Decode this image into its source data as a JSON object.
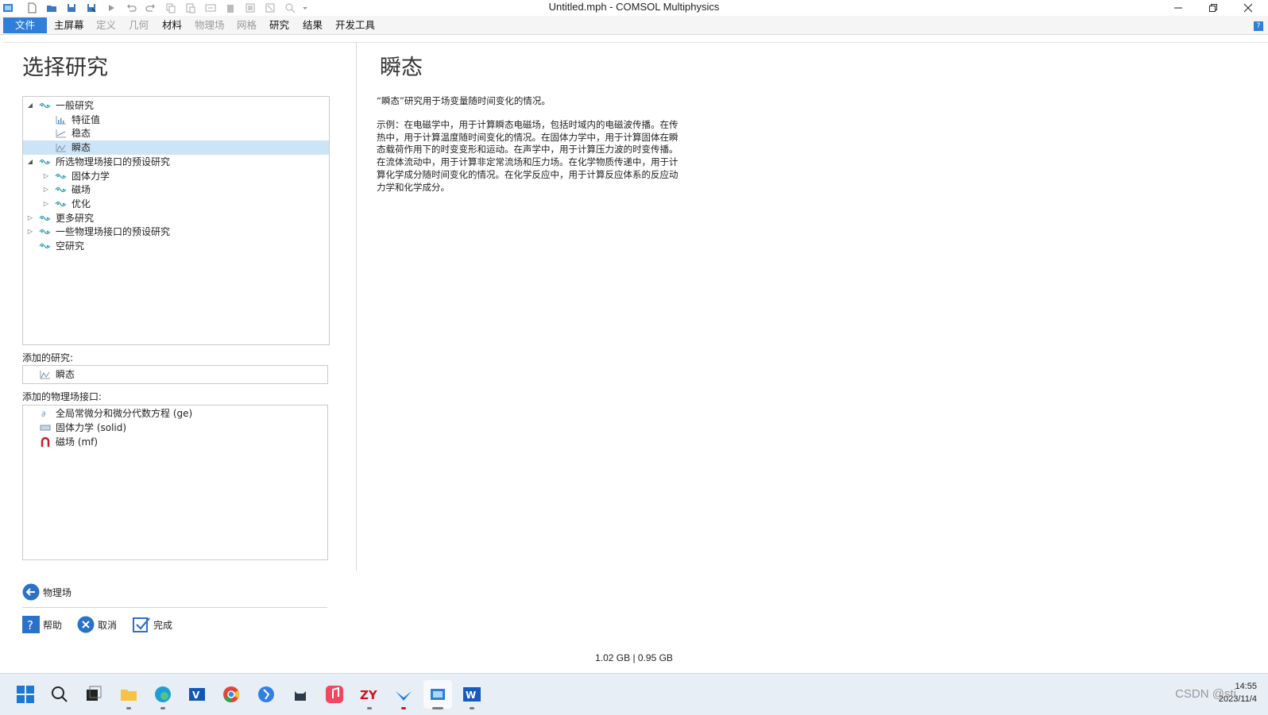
{
  "window": {
    "title": "Untitled.mph - COMSOL Multiphysics",
    "controls": [
      "minimize-icon",
      "restore-icon",
      "close-icon"
    ]
  },
  "quick_access": [
    "app-icon",
    "new-icon",
    "open-icon",
    "save-icon",
    "save-as-icon",
    "run-icon",
    "undo-icon",
    "redo-icon",
    "copy-icon",
    "paste-icon",
    "duplicate-icon",
    "delete-icon",
    "select-icon",
    "deselect-icon",
    "zoom-icon",
    "dropdown-icon"
  ],
  "menu": {
    "file": "文件",
    "items": [
      {
        "label": "主屏幕",
        "enabled": true
      },
      {
        "label": "定义",
        "enabled": false
      },
      {
        "label": "几何",
        "enabled": false
      },
      {
        "label": "材料",
        "enabled": true
      },
      {
        "label": "物理场",
        "enabled": false
      },
      {
        "label": "网格",
        "enabled": false
      },
      {
        "label": "研究",
        "enabled": true
      },
      {
        "label": "结果",
        "enabled": true
      },
      {
        "label": "开发工具",
        "enabled": true
      }
    ],
    "help": "?"
  },
  "left": {
    "title": "选择研究",
    "tree": [
      {
        "label": "一般研究",
        "level": 0,
        "expander": "expanded",
        "icon": "study-icon"
      },
      {
        "label": "特征值",
        "level": 1,
        "expander": "none",
        "icon": "eigenvalue-icon"
      },
      {
        "label": "稳态",
        "level": 1,
        "expander": "none",
        "icon": "stationary-icon"
      },
      {
        "label": "瞬态",
        "level": 1,
        "expander": "none",
        "icon": "transient-icon",
        "selected": true
      },
      {
        "label": "所选物理场接口的预设研究",
        "level": 0,
        "expander": "expanded",
        "icon": "study-icon"
      },
      {
        "label": "固体力学",
        "level": 1,
        "expander": "collapsed",
        "icon": "study-icon"
      },
      {
        "label": "磁场",
        "level": 1,
        "expander": "collapsed",
        "icon": "study-icon"
      },
      {
        "label": "优化",
        "level": 1,
        "expander": "collapsed",
        "icon": "study-icon"
      },
      {
        "label": "更多研究",
        "level": 0,
        "expander": "collapsed",
        "icon": "study-icon"
      },
      {
        "label": "一些物理场接口的预设研究",
        "level": 0,
        "expander": "collapsed",
        "icon": "study-icon"
      },
      {
        "label": "空研究",
        "level": 0,
        "expander": "none",
        "icon": "study-icon"
      }
    ],
    "added_studies_label": "添加的研究:",
    "added_studies": [
      {
        "label": "瞬态",
        "icon": "transient-icon"
      }
    ],
    "added_physics_label": "添加的物理场接口:",
    "added_physics": [
      {
        "label": "全局常微分和微分代数方程 (ge)",
        "icon": "ode-icon"
      },
      {
        "label": "固体力学 (solid)",
        "icon": "solid-mechanics-icon"
      },
      {
        "label": "磁场 (mf)",
        "icon": "magnet-icon"
      }
    ],
    "back_button": "物理场",
    "help_button": "帮助",
    "cancel_button": "取消",
    "done_button": "完成"
  },
  "right": {
    "title": "瞬态",
    "desc1": "“瞬态”研究用于场变量随时间变化的情况。",
    "desc2_lines": [
      "示例：在电磁学中，用于计算瞬态电磁场，包括时域内的电磁波传播。在传",
      "热中，用于计算温度随时间变化的情况。在固体力学中，用于计算固体在瞬",
      "态载荷作用下的时变变形和运动。在声学中，用于计算压力波的时变传播。",
      "在流体流动中，用于计算非定常流场和压力场。在化学物质传递中，用于计",
      "算化学成分随时间变化的情况。在化学反应中，用于计算反应体系的反应动",
      "力学和化学成分。"
    ]
  },
  "status": {
    "memory": "1.02 GB | 0.95 GB"
  },
  "taskbar": {
    "apps": [
      "windows-start-icon",
      "search-icon",
      "task-view-icon",
      "file-explorer-icon",
      "edge-icon",
      "outlook-icon",
      "chrome-icon",
      "feishu-icon",
      "cat-app-icon",
      "music-icon",
      "zy-icon",
      "swallow-app-icon",
      "comsol-icon",
      "word-icon"
    ],
    "clock_time": "14:55",
    "clock_date": "2023/11/4"
  },
  "watermark": "CSDN @sti",
  "colors": {
    "accent": "#2f7fd8",
    "selection": "#cce4f7",
    "tree_icon": "#3aa0b8"
  }
}
